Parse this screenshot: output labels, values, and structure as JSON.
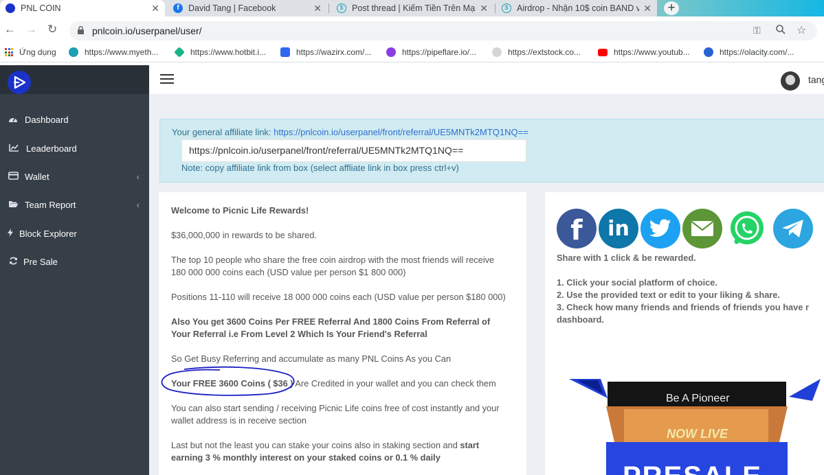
{
  "browser": {
    "tabs": [
      {
        "title": "PNL COIN"
      },
      {
        "title": "David Tang | Facebook"
      },
      {
        "title": "Post thread | Kiếm Tiền Trên Mạng"
      },
      {
        "title": "Airdrop - Nhận 10$ coin BAND v"
      }
    ],
    "url": "pnlcoin.io/userpanel/user/",
    "bookmarks": [
      "Ứng dụng",
      "https://www.myeth...",
      "https://www.hotbit.i...",
      "https://wazirx.com/...",
      "https://pipeflare.io/...",
      "https://extstock.co...",
      "https://www.youtub...",
      "https://olacity.com/..."
    ]
  },
  "sidebar": {
    "items": [
      {
        "label": "Dashboard"
      },
      {
        "label": "Leaderboard"
      },
      {
        "label": "Wallet"
      },
      {
        "label": "Team Report"
      },
      {
        "label": "Block Explorer"
      },
      {
        "label": "Pre Sale"
      }
    ]
  },
  "header": {
    "username": "tang"
  },
  "affiliate": {
    "label": "Your general affiliate link: ",
    "link": "https://pnlcoin.io/userpanel/front/referral/UE5MNTk2MTQ1NQ==",
    "box_value": "https://pnlcoin.io/userpanel/front/referral/UE5MNTk2MTQ1NQ==",
    "note": "Note: copy affiliate link from box (select affliate link in box press ctrl+v)"
  },
  "rewards": {
    "welcome": "Welcome to Picnic Life Rewards!",
    "p1": "$36,000,000 in rewards to be shared.",
    "p2": "The top 10 people who share the free coin airdrop with the most friends will receive 180 000 000 coins each (USD value per person $1 800 000)",
    "p3": "Positions 11-110 will receive 18 000 000 coins each (USD value per person $180 000)",
    "p4": "Also You get 3600 Coins Per FREE Referral And 1800 Coins From Referral of Your Referral i.e From Level 2 Which Is Your Friend's Referral",
    "p5": "So Get Busy Referring and accumulate as many PNL Coins As you Can",
    "p6_bold": "Your FREE 3600 Coins ( $36 )",
    "p6_rest": " Are Credited in your wallet and you can check them",
    "p7": "You can also start sending / receiving Picnic Life coins free of cost instantly and your wallet address is in receive section",
    "p8_normal": "Last but not the least you can stake your coins also in staking section and ",
    "p8_bold": "start earning 3 % monthly interest on your staked coins or 0.1 % daily"
  },
  "share": {
    "headline": "Share with 1 click & be rewarded.",
    "steps": [
      "1. Click your social platform of choice.",
      "2. Use the provided text or edit to your liking & share.",
      "3. Check how many friends and friends of friends you have r"
    ],
    "step3_cont": "dashboard."
  },
  "banner": {
    "pioneer": "Be A Pioneer",
    "live": "NOW LIVE",
    "presale": "PRESALE"
  },
  "colors": {
    "sidebar": "#363e47",
    "facebook": "#3b5998",
    "linkedin": "#0e76a8",
    "twitter": "#1da1f2",
    "mail": "#5d9636",
    "whatsapp": "#25d366",
    "telegram": "#2ca5e0",
    "annotation": "#1a1fc4"
  }
}
